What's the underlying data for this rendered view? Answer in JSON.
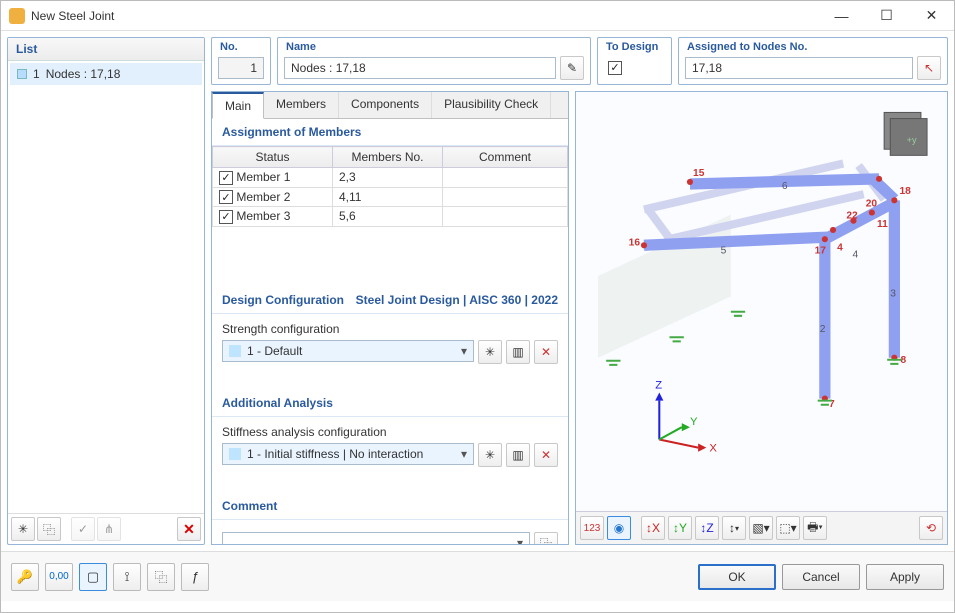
{
  "window": {
    "title": "New Steel Joint"
  },
  "list": {
    "header": "List",
    "items": [
      {
        "index": "1",
        "text": "Nodes : 17,18"
      }
    ]
  },
  "top": {
    "no_label": "No.",
    "no_value": "1",
    "name_label": "Name",
    "name_value": "Nodes : 17,18",
    "todesign_label": "To Design",
    "todesign_checked": true,
    "nodes_label": "Assigned to Nodes No.",
    "nodes_value": "17,18"
  },
  "tabs": [
    "Main",
    "Members",
    "Components",
    "Plausibility Check"
  ],
  "members_section": {
    "title": "Assignment of Members",
    "columns": [
      "Status",
      "Members No.",
      "Comment"
    ],
    "rows": [
      {
        "checked": true,
        "status": "Member 1",
        "members": "2,3",
        "comment": ""
      },
      {
        "checked": true,
        "status": "Member 2",
        "members": "4,11",
        "comment": ""
      },
      {
        "checked": true,
        "status": "Member 3",
        "members": "5,6",
        "comment": ""
      }
    ]
  },
  "design_cfg": {
    "title": "Design Configuration",
    "subtitle": "Steel Joint Design | AISC 360 | 2022",
    "label": "Strength configuration",
    "value": "1 - Default"
  },
  "analysis": {
    "title": "Additional Analysis",
    "label": "Stiffness analysis configuration",
    "value": "1 - Initial stiffness | No interaction"
  },
  "comment_section": {
    "title": "Comment",
    "value": ""
  },
  "viewport": {
    "nodes": {
      "15": "15",
      "16": "16",
      "17": "17",
      "18": "18",
      "20": "20",
      "22": "22",
      "11": "11",
      "4": "4",
      "7": "7",
      "8": "8"
    },
    "members": {
      "2": "2",
      "3": "3",
      "4": "4",
      "5": "5",
      "6": "6"
    },
    "axes": {
      "x": "X",
      "y": "Y",
      "z": "Z"
    }
  },
  "footer": {
    "ok": "OK",
    "cancel": "Cancel",
    "apply": "Apply"
  }
}
